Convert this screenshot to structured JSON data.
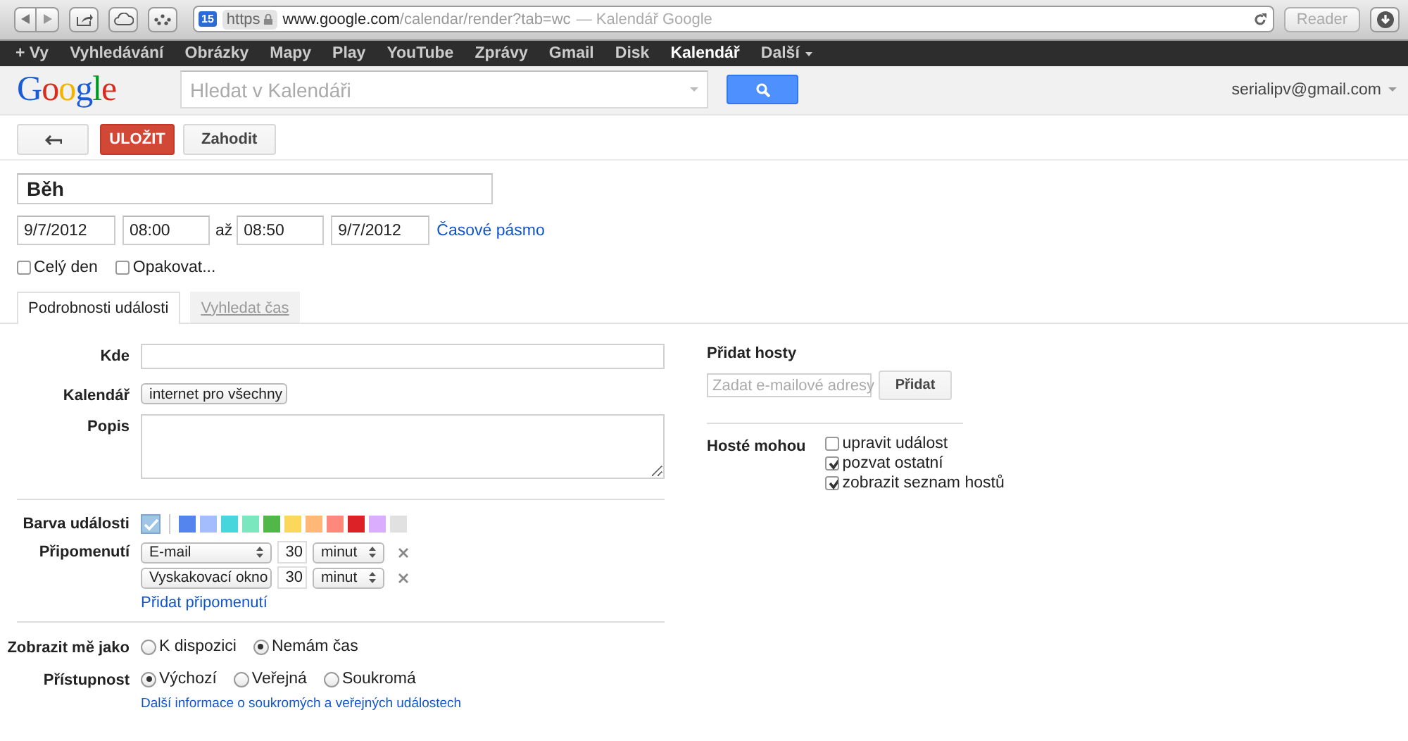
{
  "browser": {
    "favicon_badge": "15",
    "scheme": "https",
    "host": "www.google.com",
    "path": "/calendar/render?tab=wc",
    "page_title": "— Kalendář Google",
    "reader": "Reader"
  },
  "nav": {
    "items": [
      {
        "label": "+ Vy",
        "selected": false
      },
      {
        "label": "Vyhledávání",
        "selected": false
      },
      {
        "label": "Obrázky",
        "selected": false
      },
      {
        "label": "Mapy",
        "selected": false
      },
      {
        "label": "Play",
        "selected": false
      },
      {
        "label": "YouTube",
        "selected": false
      },
      {
        "label": "Zprávy",
        "selected": false
      },
      {
        "label": "Gmail",
        "selected": false
      },
      {
        "label": "Disk",
        "selected": false
      },
      {
        "label": "Kalendář",
        "selected": true
      },
      {
        "label": "Další",
        "selected": false,
        "menu": true
      }
    ]
  },
  "header": {
    "logo": "Google",
    "search_placeholder": "Hledat v Kalendáři",
    "account": "serialipv@gmail.com"
  },
  "actions": {
    "save": "ULOŽIT",
    "discard": "Zahodit"
  },
  "event": {
    "title": "Běh",
    "start_date": "9/7/2012",
    "start_time": "08:00",
    "to": "až",
    "end_time": "08:50",
    "end_date": "9/7/2012",
    "timezone_link": "Časové pásmo",
    "options": [
      {
        "label": "Celý den",
        "checked": false
      },
      {
        "label": "Opakovat...",
        "checked": false
      }
    ]
  },
  "tabs": [
    {
      "label": "Podrobnosti události",
      "selected": true
    },
    {
      "label": "Vyhledat čas",
      "selected": false
    }
  ],
  "form": {
    "where": {
      "label": "Kde"
    },
    "calendar": {
      "label": "Kalendář",
      "value": "internet pro všechny"
    },
    "description": {
      "label": "Popis"
    },
    "color": {
      "label": "Barva události",
      "swatches": [
        {
          "color": "#9fc6e7",
          "selected": true
        },
        {
          "color": "#5484ed",
          "selected": false
        },
        {
          "color": "#a4bdfc",
          "selected": false
        },
        {
          "color": "#46d6db",
          "selected": false
        },
        {
          "color": "#7ae7bf",
          "selected": false
        },
        {
          "color": "#51b749",
          "selected": false
        },
        {
          "color": "#fbd75b",
          "selected": false
        },
        {
          "color": "#ffb878",
          "selected": false
        },
        {
          "color": "#ff887c",
          "selected": false
        },
        {
          "color": "#dc2127",
          "selected": false
        },
        {
          "color": "#dbadff",
          "selected": false
        },
        {
          "color": "#e1e1e1",
          "selected": false
        }
      ]
    },
    "reminders": {
      "label": "Připomenutí",
      "items": [
        {
          "method": "E-mail",
          "amount": "30",
          "unit": "minut"
        },
        {
          "method": "Vyskakovací okno",
          "amount": "30",
          "unit": "minut"
        }
      ],
      "add_link": "Přidat připomenutí"
    },
    "show_as": {
      "label": "Zobrazit mě jako",
      "options": [
        {
          "label": "K dispozici",
          "selected": false
        },
        {
          "label": "Nemám čas",
          "selected": true
        }
      ]
    },
    "privacy": {
      "label": "Přístupnost",
      "options": [
        {
          "label": "Výchozí",
          "selected": true
        },
        {
          "label": "Veřejná",
          "selected": false
        },
        {
          "label": "Soukromá",
          "selected": false
        }
      ],
      "info_link": "Další informace o soukromých a veřejných událostech"
    }
  },
  "guests": {
    "title": "Přidat hosty",
    "placeholder": "Zadat e-mailové adresy",
    "add_button": "Přidat",
    "permissions": {
      "label": "Hosté mohou",
      "options": [
        {
          "label": "upravit událost",
          "checked": false
        },
        {
          "label": "pozvat ostatní",
          "checked": true
        },
        {
          "label": "zobrazit seznam hostů",
          "checked": true
        }
      ]
    }
  }
}
